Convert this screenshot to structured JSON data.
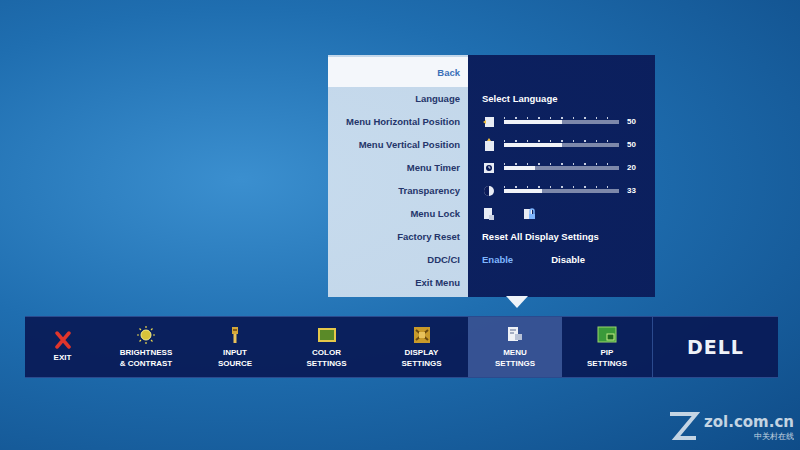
{
  "menu": {
    "rows": [
      {
        "kind": "back",
        "label": "Back",
        "selected": true
      },
      {
        "kind": "value",
        "label": "Language",
        "value": "Select Language"
      },
      {
        "kind": "slider",
        "label": "Menu Horizontal Position",
        "level": 0.5,
        "reading": "50"
      },
      {
        "kind": "slider",
        "label": "Menu Vertical Position",
        "level": 0.5,
        "reading": "50"
      },
      {
        "kind": "slider",
        "label": "Menu Timer",
        "level": 0.27,
        "reading": "20"
      },
      {
        "kind": "slider",
        "label": "Transparency",
        "level": 0.33,
        "reading": "33"
      },
      {
        "kind": "lock",
        "label": "Menu Lock"
      },
      {
        "kind": "value",
        "label": "Factory Reset",
        "value": "Reset All Display Settings"
      },
      {
        "kind": "choice",
        "label": "DDC/CI",
        "options": [
          {
            "label": "Enable",
            "selected": true
          },
          {
            "label": "Disable",
            "selected": false
          }
        ]
      },
      {
        "kind": "plain",
        "label": "Exit Menu"
      }
    ]
  },
  "toolbar": {
    "items": [
      {
        "kind": "exit",
        "lines": [
          "EXIT"
        ],
        "selected": false
      },
      {
        "kind": "brightness",
        "lines": [
          "BRIGHTNESS",
          "& CONTRAST"
        ],
        "selected": false
      },
      {
        "kind": "input",
        "lines": [
          "INPUT",
          "SOURCE"
        ],
        "selected": false
      },
      {
        "kind": "color",
        "lines": [
          "COLOR",
          "SETTINGS"
        ],
        "selected": false
      },
      {
        "kind": "display",
        "lines": [
          "DISPLAY",
          "SETTINGS"
        ],
        "selected": false
      },
      {
        "kind": "menu",
        "lines": [
          "MENU",
          "SETTINGS"
        ],
        "selected": true
      },
      {
        "kind": "pip",
        "lines": [
          "PIP",
          "SETTINGS"
        ],
        "selected": false
      }
    ],
    "logo": "DELL"
  },
  "watermark": {
    "text": "zol.com.cn",
    "subtext": "中关村在线"
  }
}
